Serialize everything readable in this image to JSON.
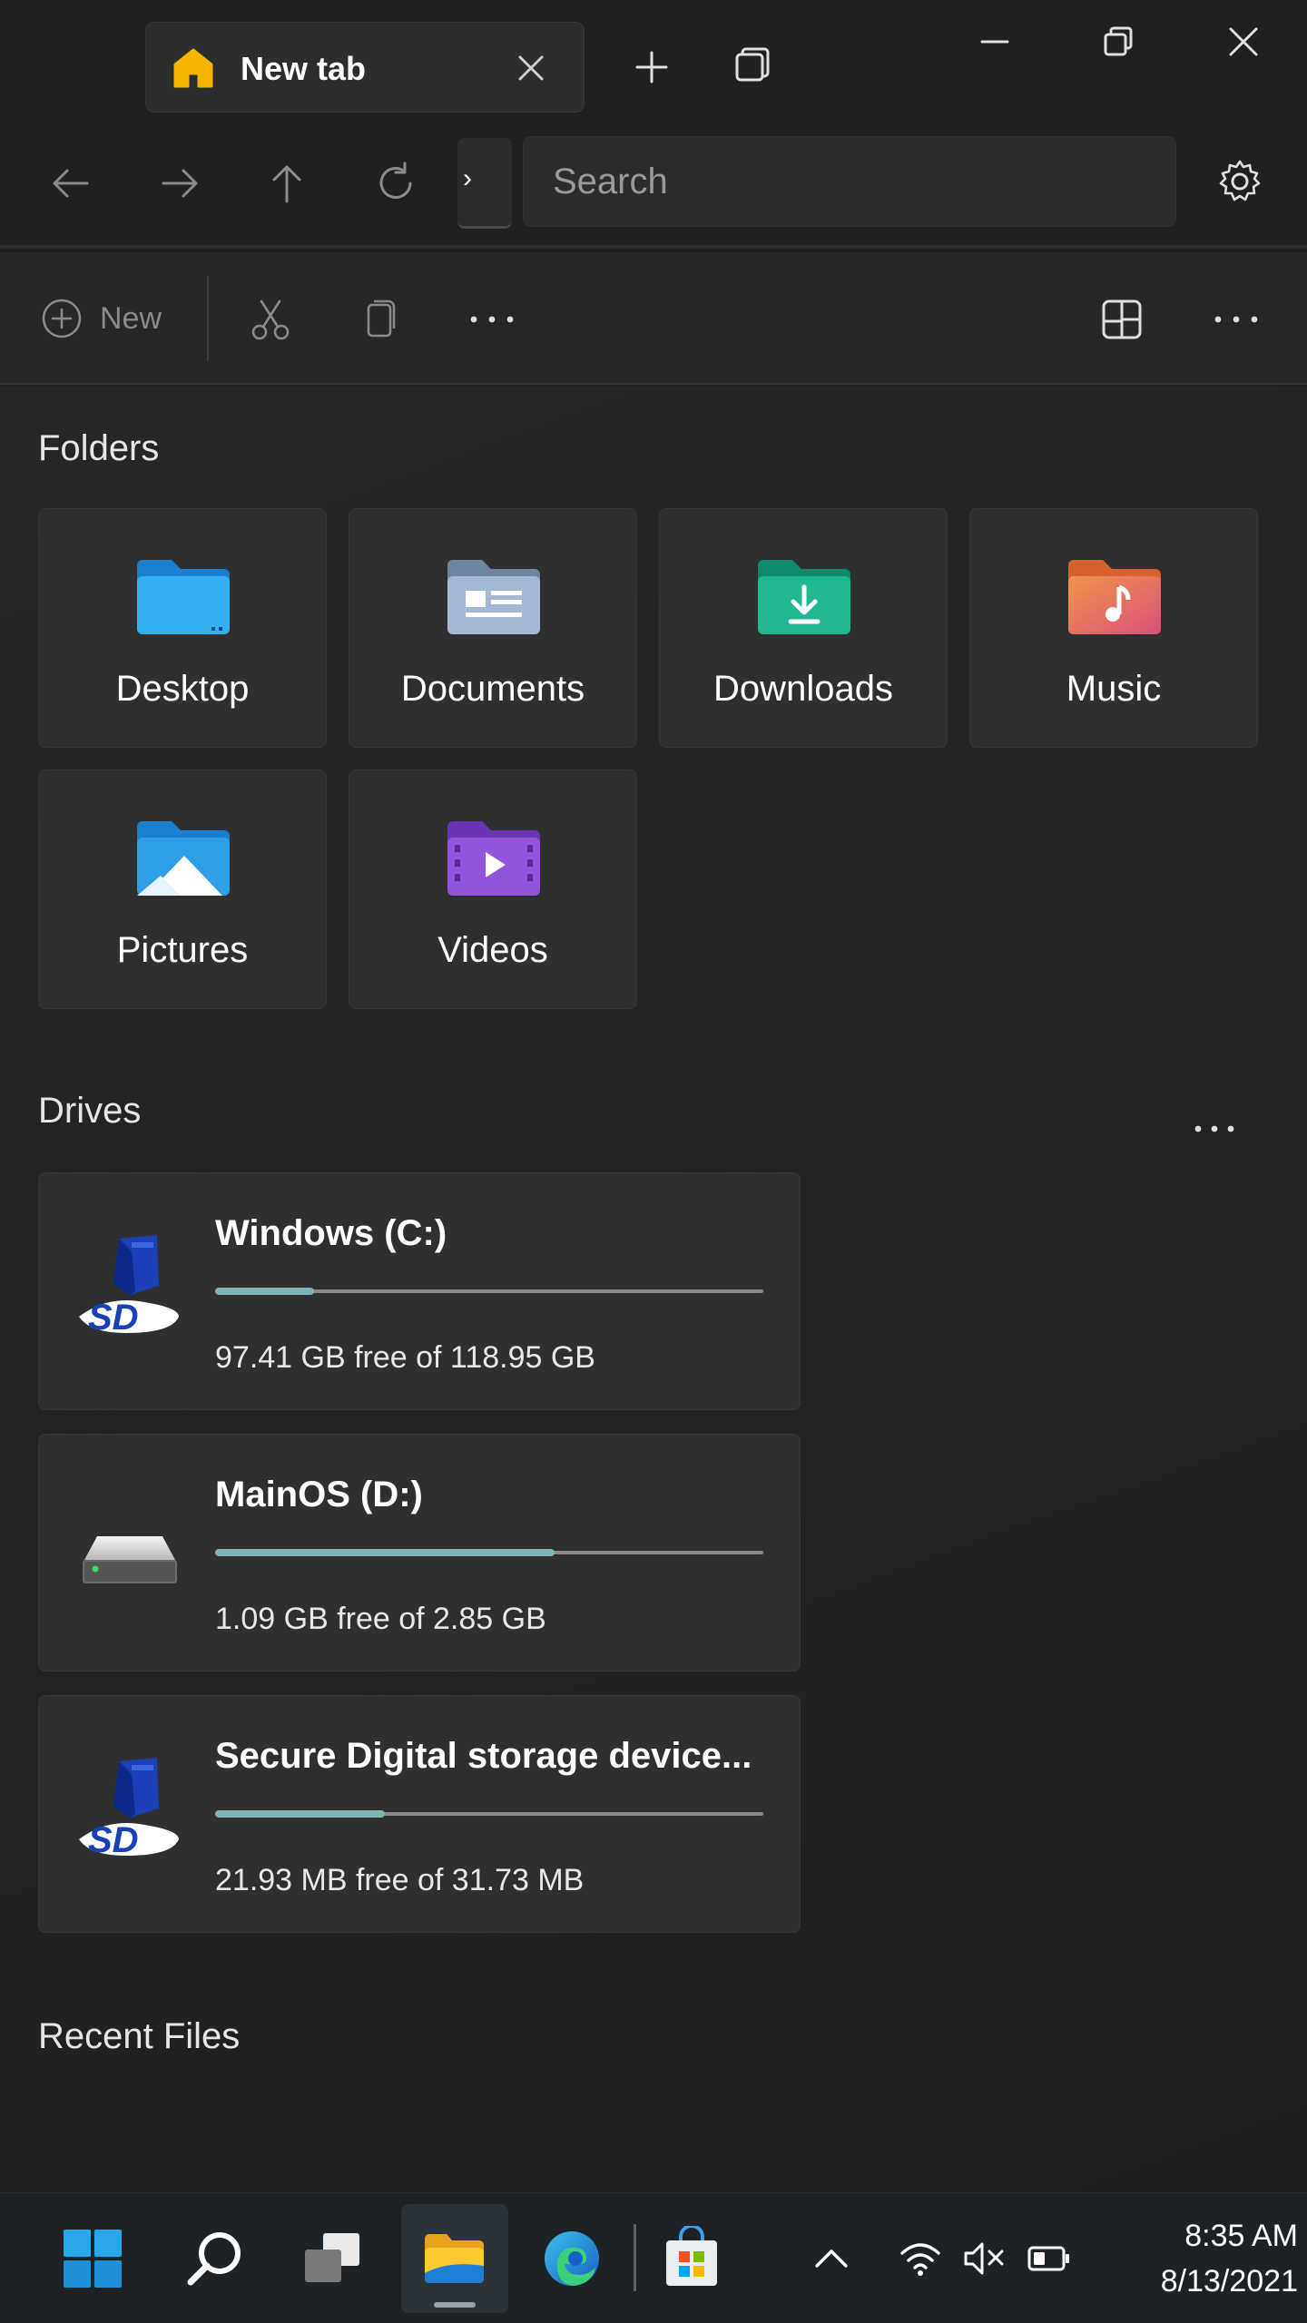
{
  "tab": {
    "title": "New tab"
  },
  "search": {
    "placeholder": "Search"
  },
  "toolbar": {
    "new_label": "New",
    "crumb_chevron": "›"
  },
  "sections": {
    "folders": "Folders",
    "drives": "Drives",
    "recent": "Recent Files"
  },
  "folders": [
    {
      "label": "Desktop",
      "icon": "desktop-folder-icon",
      "color": "#2fa6ea"
    },
    {
      "label": "Documents",
      "icon": "documents-folder-icon",
      "color": "#8aa4c2"
    },
    {
      "label": "Downloads",
      "icon": "downloads-folder-icon",
      "color": "#20a88c"
    },
    {
      "label": "Music",
      "icon": "music-folder-icon",
      "color": "#e8775a"
    },
    {
      "label": "Pictures",
      "icon": "pictures-folder-icon",
      "color": "#2f9ee6"
    },
    {
      "label": "Videos",
      "icon": "videos-folder-icon",
      "color": "#8b4fcf"
    }
  ],
  "drives": [
    {
      "name": "Windows (C:)",
      "free": "97.41 GB free of 118.95 GB",
      "icon": "sd-card-icon",
      "used_fraction": 0.18
    },
    {
      "name": "MainOS (D:)",
      "free": "1.09 GB free of 2.85 GB",
      "icon": "hard-drive-icon",
      "used_fraction": 0.62
    },
    {
      "name": "Secure Digital storage device...",
      "free": "21.93 MB free of 31.73 MB",
      "icon": "sd-card-icon",
      "used_fraction": 0.31
    }
  ],
  "taskbar": {
    "time": "8:35 AM",
    "date": "8/13/2021"
  },
  "colors": {
    "accent": "#7fb6b6",
    "background": "#202020",
    "card": "#2f2f2f"
  }
}
